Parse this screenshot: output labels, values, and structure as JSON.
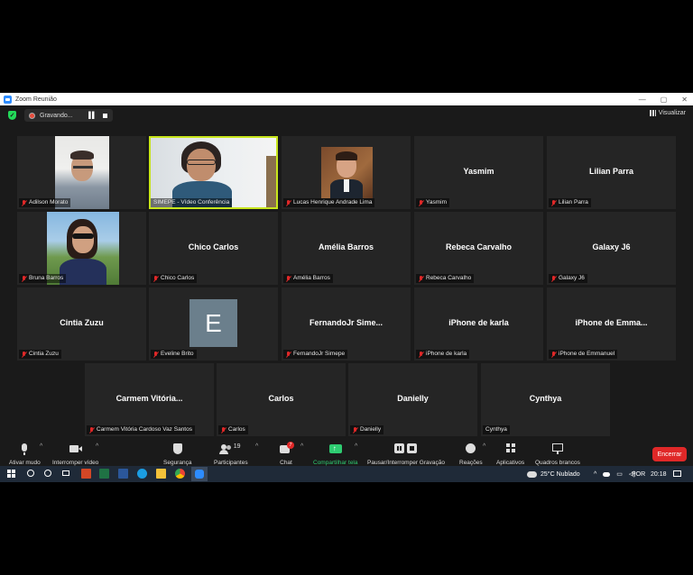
{
  "window": {
    "title": "Zoom Reunião",
    "controls": [
      "—",
      "▢",
      "✕"
    ]
  },
  "meeting": {
    "recording_label": "Gravando...",
    "view_label": "Visualizar"
  },
  "tiles": [
    {
      "label": "Adilson Morato",
      "name": "",
      "photo": true
    },
    {
      "label": "SIMEPE - Vídeo Conferência",
      "name": "",
      "photo": true,
      "active": true
    },
    {
      "label": "Lucas Henrique Andrade Lima",
      "name": "",
      "photo": true
    },
    {
      "label": "Yasmim",
      "name": "Yasmim"
    },
    {
      "label": "Lilian Parra",
      "name": "Lilian Parra"
    },
    {
      "label": "Bruna Barros",
      "name": "",
      "photo": true
    },
    {
      "label": "Chico Carlos",
      "name": "Chico Carlos"
    },
    {
      "label": "Amélia Barros",
      "name": "Amélia Barros"
    },
    {
      "label": "Rebeca Carvalho",
      "name": "Rebeca Carvalho"
    },
    {
      "label": "Galaxy J6",
      "name": "Galaxy J6"
    },
    {
      "label": "Cintia Zuzu",
      "name": "Cintia Zuzu"
    },
    {
      "label": "Eveline Brito",
      "name": "",
      "avatar_letter": "E"
    },
    {
      "label": "FernandoJr Simepe",
      "name": "FernandoJr  Sime..."
    },
    {
      "label": "iPhone de karla",
      "name": "iPhone de karla"
    },
    {
      "label": "iPhone de Emmanuel",
      "name": "iPhone  de  Emma..."
    },
    {
      "label": "Carmem Vitória Cardoso Vaz Santos",
      "name": "Carmem  Vitória..."
    },
    {
      "label": "Carlos",
      "name": "Carlos"
    },
    {
      "label": "Danielly",
      "name": "Danielly"
    },
    {
      "label": "Cynthya",
      "name": "Cynthya",
      "unmuted": true
    }
  ],
  "toolbar": {
    "mute": "Ativar mudo",
    "video": "Interromper vídeo",
    "security": "Segurança",
    "participants": "Participantes",
    "participants_count": "19",
    "chat": "Chat",
    "chat_badge": "7",
    "share": "Compartilhar tela",
    "record": "Pausar/Interromper Gravação",
    "reactions": "Reações",
    "apps": "Aplicativos",
    "whiteboards": "Quadros brancos",
    "end": "Encerrar"
  },
  "taskbar": {
    "weather": "25°C  Nublado",
    "lang": "POR",
    "time": "20:18"
  },
  "colors": {
    "active_outline": "#c8e61c",
    "share_green": "#2ecc71",
    "end_red": "#e02828",
    "muted_red": "#e02828"
  }
}
